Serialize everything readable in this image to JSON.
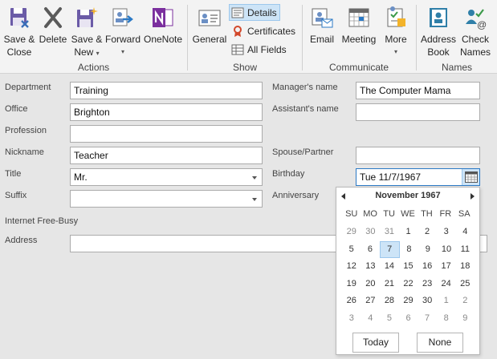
{
  "ribbon": {
    "actions": {
      "group_label": "Actions",
      "save_close": [
        "Save &",
        "Close"
      ],
      "delete": "Delete",
      "save_new": [
        "Save &",
        "New"
      ],
      "forward": "Forward",
      "onenote": "OneNote"
    },
    "show": {
      "group_label": "Show",
      "general": "General",
      "details": "Details",
      "certificates": "Certificates",
      "all_fields": "All Fields"
    },
    "communicate": {
      "group_label": "Communicate",
      "email": "Email",
      "meeting": "Meeting",
      "more": "More"
    },
    "names": {
      "group_label": "Names",
      "address_book": [
        "Address",
        "Book"
      ],
      "check_names": [
        "Check",
        "Names"
      ]
    }
  },
  "form": {
    "department": {
      "label": "Department",
      "value": "Training"
    },
    "office": {
      "label": "Office",
      "value": "Brighton"
    },
    "profession": {
      "label": "Profession",
      "value": ""
    },
    "nickname": {
      "label": "Nickname",
      "value": "Teacher"
    },
    "title": {
      "label": "Title",
      "value": "Mr."
    },
    "suffix": {
      "label": "Suffix",
      "value": ""
    },
    "internet_free_busy": {
      "label": "Internet Free-Busy"
    },
    "address": {
      "label": "Address",
      "value": ""
    },
    "managers_name": {
      "label": "Manager's name",
      "value": "The Computer Mama"
    },
    "assistants_name": {
      "label": "Assistant's name",
      "value": ""
    },
    "spouse_partner": {
      "label": "Spouse/Partner",
      "value": ""
    },
    "birthday": {
      "label": "Birthday",
      "value": "Tue 11/7/1967"
    },
    "anniversary": {
      "label": "Anniversary"
    }
  },
  "calendar": {
    "month_label": "November 1967",
    "weekdays": [
      "SU",
      "MO",
      "TU",
      "WE",
      "TH",
      "FR",
      "SA"
    ],
    "weeks": [
      [
        "29",
        "30",
        "31",
        "1",
        "2",
        "3",
        "4"
      ],
      [
        "5",
        "6",
        "7",
        "8",
        "9",
        "10",
        "11"
      ],
      [
        "12",
        "13",
        "14",
        "15",
        "16",
        "17",
        "18"
      ],
      [
        "19",
        "20",
        "21",
        "22",
        "23",
        "24",
        "25"
      ],
      [
        "26",
        "27",
        "28",
        "29",
        "30",
        "1",
        "2"
      ],
      [
        "3",
        "4",
        "5",
        "6",
        "7",
        "8",
        "9"
      ]
    ],
    "selected_day": "7",
    "today_label": "Today",
    "none_label": "None"
  },
  "colors": {
    "selected_bg": "#cde4f7",
    "selected_border": "#9cc7ec",
    "onenote_purple": "#7b2f9e",
    "accent_blue": "#2b79c5"
  },
  "icons": [
    "save-close-icon",
    "delete-icon",
    "save-new-icon",
    "forward-icon",
    "onenote-icon",
    "general-icon",
    "details-icon",
    "certificate-icon",
    "all-fields-icon",
    "email-icon",
    "meeting-icon",
    "more-icon",
    "address-book-icon",
    "check-names-icon",
    "calendar-icon"
  ]
}
